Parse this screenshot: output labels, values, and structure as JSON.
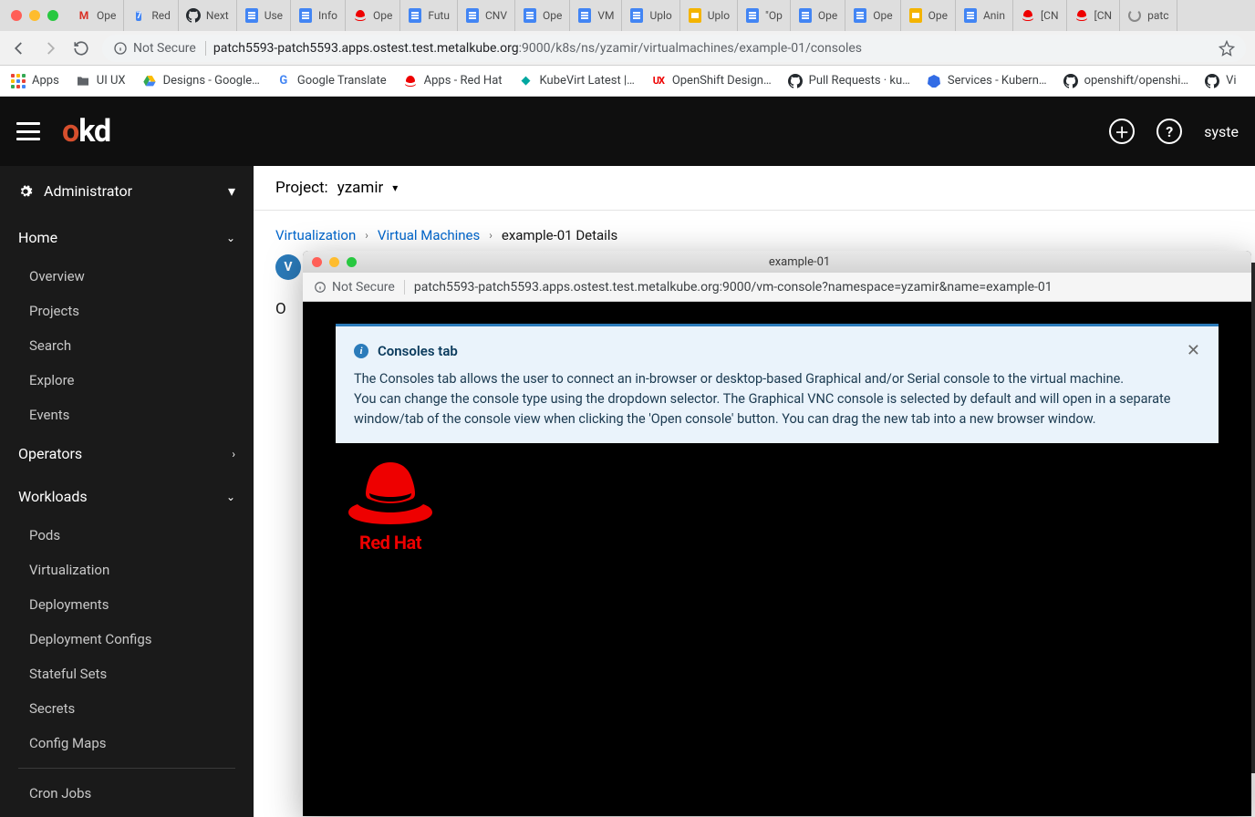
{
  "browser": {
    "tabs": [
      {
        "fav": "gmail",
        "label": "Ope"
      },
      {
        "fav": "cal",
        "cal": "7",
        "label": "Red"
      },
      {
        "fav": "gh",
        "label": "Next"
      },
      {
        "fav": "gdoc",
        "label": "Use"
      },
      {
        "fav": "gdoc",
        "label": "Info"
      },
      {
        "fav": "rh",
        "label": "Ope"
      },
      {
        "fav": "gdoc",
        "label": "Futu"
      },
      {
        "fav": "gdoc",
        "label": "CNV"
      },
      {
        "fav": "gdoc",
        "label": "Ope"
      },
      {
        "fav": "gdoc",
        "label": "VM"
      },
      {
        "fav": "gdoc",
        "label": "Uplo"
      },
      {
        "fav": "gslide",
        "label": "Uplo"
      },
      {
        "fav": "gdoc",
        "label": "\"Op"
      },
      {
        "fav": "gdoc",
        "label": "Ope"
      },
      {
        "fav": "gdoc",
        "label": "Ope"
      },
      {
        "fav": "gslide",
        "label": "Ope"
      },
      {
        "fav": "gdoc",
        "label": "Anin"
      },
      {
        "fav": "rh",
        "label": "[CN"
      },
      {
        "fav": "rh",
        "label": "[CN"
      },
      {
        "fav": "spin",
        "label": "patc"
      }
    ],
    "not_secure": "Not Secure",
    "url_host": "patch5593-patch5593.apps.ostest.test.metalkube.org",
    "url_path": ":9000/k8s/ns/yzamir/virtualmachines/example-01/consoles",
    "bookmarks": [
      {
        "icon": "apps",
        "label": "Apps"
      },
      {
        "icon": "folder",
        "label": "UI UX"
      },
      {
        "icon": "gdrive",
        "label": "Designs - Google…"
      },
      {
        "icon": "gt",
        "label": "Google Translate"
      },
      {
        "icon": "rh",
        "label": "Apps - Red Hat"
      },
      {
        "icon": "kv",
        "label": "KubeVirt Latest |…"
      },
      {
        "icon": "ux",
        "label": "OpenShift Design…"
      },
      {
        "icon": "gh",
        "label": "Pull Requests · ku…"
      },
      {
        "icon": "k8s",
        "label": "Services - Kubern…"
      },
      {
        "icon": "gh",
        "label": "openshift/openshi…"
      },
      {
        "icon": "gh",
        "label": "Vi"
      }
    ]
  },
  "okd": {
    "perspective": "Administrator",
    "user": "syste",
    "nav": {
      "home": {
        "label": "Home",
        "items": [
          "Overview",
          "Projects",
          "Search",
          "Explore",
          "Events"
        ]
      },
      "operators": {
        "label": "Operators"
      },
      "workloads": {
        "label": "Workloads",
        "items": [
          "Pods",
          "Virtualization",
          "Deployments",
          "Deployment Configs",
          "Stateful Sets",
          "Secrets",
          "Config Maps",
          "Cron Jobs"
        ]
      }
    },
    "project_prefix": "Project:",
    "project_name": "yzamir",
    "breadcrumbs": {
      "a": "Virtualization",
      "b": "Virtual Machines",
      "c": "example-01 Details"
    },
    "tab_peek": "O"
  },
  "popup": {
    "title": "example-01",
    "not_secure": "Not Secure",
    "url_host": "patch5593-patch5593.apps.ostest.test.metalkube.org",
    "url_path": ":9000/vm-console?namespace=yzamir&name=example-01",
    "alert_title": "Consoles tab",
    "alert_body_1": "The Consoles tab allows the user to connect an in-browser or desktop-based Graphical and/or Serial console to the virtual machine.",
    "alert_body_2": "You can change the console type using the dropdown selector. The Graphical VNC console is selected by default and will open in a separate window/tab of the console view when clicking the 'Open console' button. You can drag the new tab into a new browser window.",
    "logo_text": "Red Hat"
  }
}
